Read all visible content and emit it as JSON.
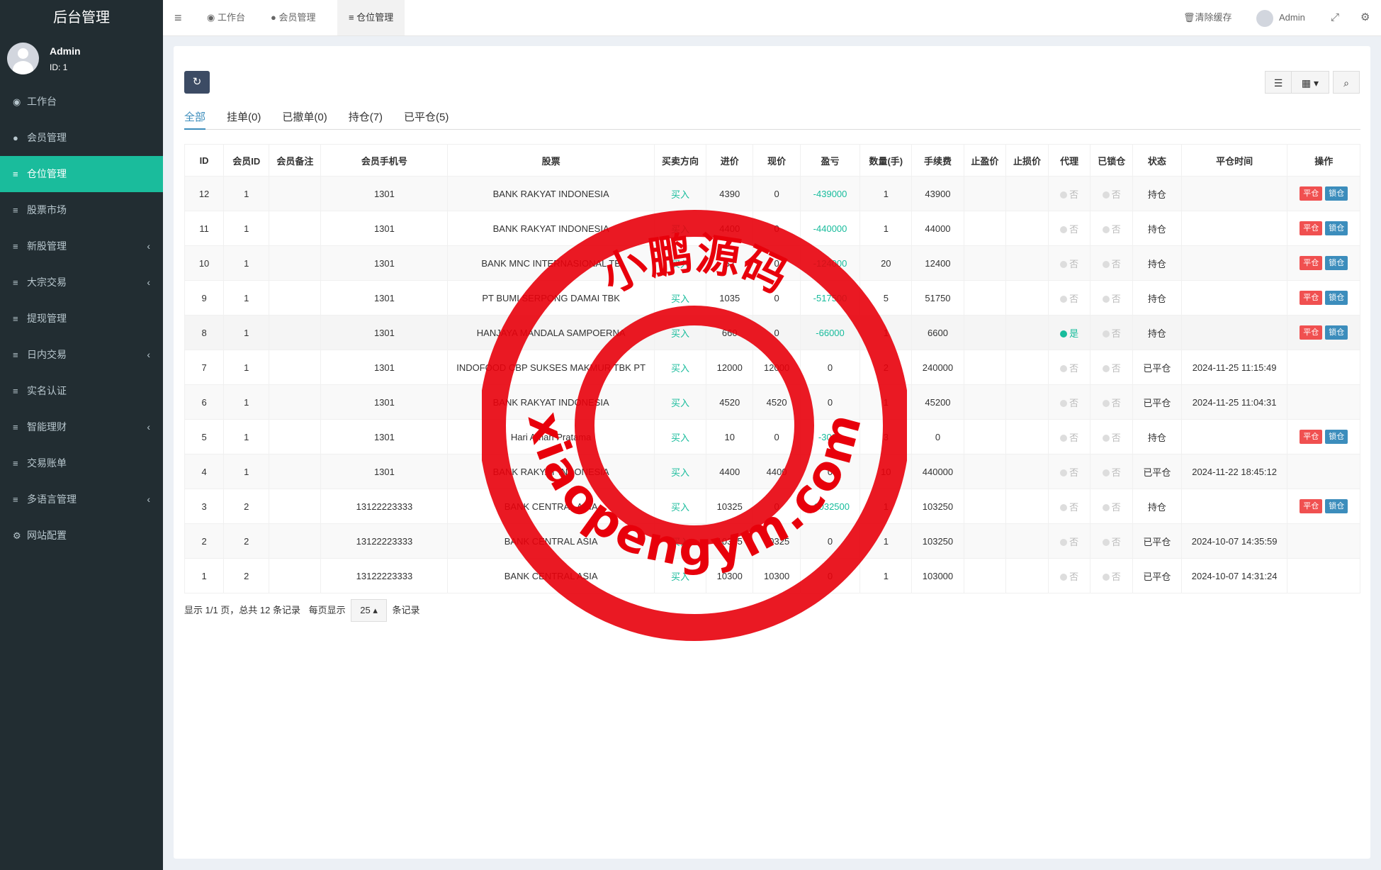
{
  "sidebar": {
    "brand": "后台管理",
    "user": {
      "name": "Admin",
      "id": "ID: 1"
    },
    "items": [
      {
        "label": "工作台",
        "icon": "dashboard-icon",
        "glyph": "◉",
        "arrow": ""
      },
      {
        "label": "会员管理",
        "icon": "user-icon",
        "glyph": "●",
        "arrow": ""
      },
      {
        "label": "仓位管理",
        "icon": "list-icon",
        "glyph": "≡",
        "arrow": "",
        "active": true
      },
      {
        "label": "股票市场",
        "icon": "list-icon",
        "glyph": "≡",
        "arrow": ""
      },
      {
        "label": "新股管理",
        "icon": "list-icon",
        "glyph": "≡",
        "arrow": "‹"
      },
      {
        "label": "大宗交易",
        "icon": "list-icon",
        "glyph": "≡",
        "arrow": "‹"
      },
      {
        "label": "提现管理",
        "icon": "list-icon",
        "glyph": "≡",
        "arrow": ""
      },
      {
        "label": "日内交易",
        "icon": "list-icon",
        "glyph": "≡",
        "arrow": "‹"
      },
      {
        "label": "实名认证",
        "icon": "list-icon",
        "glyph": "≡",
        "arrow": ""
      },
      {
        "label": "智能理财",
        "icon": "list-icon",
        "glyph": "≡",
        "arrow": "‹"
      },
      {
        "label": "交易账单",
        "icon": "list-icon",
        "glyph": "≡",
        "arrow": ""
      },
      {
        "label": "多语言管理",
        "icon": "list-icon",
        "glyph": "≡",
        "arrow": "‹"
      },
      {
        "label": "网站配置",
        "icon": "gear-icon",
        "glyph": "⚙",
        "arrow": ""
      }
    ]
  },
  "header": {
    "menu_icon": "≡",
    "tabs": [
      "工作台",
      "会员管理",
      "仓位管理"
    ],
    "clear_cache": "清除缓存",
    "user": "Admin"
  },
  "filters": [
    "全部",
    "挂单(0)",
    "已撤单(0)",
    "持仓(7)",
    "已平仓(5)"
  ],
  "table": {
    "columns": [
      "ID",
      "会员ID",
      "会员备注",
      "会员手机号",
      "股票",
      "买卖方向",
      "进价",
      "现价",
      "盈亏",
      "数量(手)",
      "手续费",
      "止盈价",
      "止损价",
      "代理",
      "已锁仓",
      "状态",
      "平仓时间",
      "操作"
    ],
    "rows": [
      {
        "id": "12",
        "uid": "1",
        "note": "",
        "phone": "1301",
        "stock": "BANK RAKYAT INDONESIA",
        "dir": "买入",
        "buy": "4390",
        "now": "0",
        "pl": "-439000",
        "qty": "1",
        "fee": "43900",
        "agent": "否",
        "lock": "否",
        "status": "持仓",
        "time": "",
        "ops": true
      },
      {
        "id": "11",
        "uid": "1",
        "note": "",
        "phone": "1301",
        "stock": "BANK RAKYAT INDONESIA",
        "dir": "买入",
        "buy": "4400",
        "now": "0",
        "pl": "-440000",
        "qty": "1",
        "fee": "44000",
        "agent": "否",
        "lock": "否",
        "status": "持仓",
        "time": "",
        "ops": true
      },
      {
        "id": "10",
        "uid": "1",
        "note": "",
        "phone": "1301",
        "stock": "BANK MNC INTERNASIONAL TB",
        "dir": "买入",
        "buy": "62",
        "now": "0",
        "pl": "-124000",
        "qty": "20",
        "fee": "12400",
        "agent": "否",
        "lock": "否",
        "status": "持仓",
        "time": "",
        "ops": true
      },
      {
        "id": "9",
        "uid": "1",
        "note": "",
        "phone": "1301",
        "stock": "PT BUMI SERPONG DAMAI TBK",
        "dir": "买入",
        "buy": "1035",
        "now": "0",
        "pl": "-517500",
        "qty": "5",
        "fee": "51750",
        "agent": "否",
        "lock": "否",
        "status": "持仓",
        "time": "",
        "ops": true
      },
      {
        "id": "8",
        "uid": "1",
        "note": "",
        "phone": "1301",
        "stock": "HANJAYA MANDALA SAMPOERNA",
        "dir": "买入",
        "buy": "660",
        "now": "0",
        "pl": "-66000",
        "qty": "1",
        "fee": "6600",
        "agent": "是",
        "lock": "否",
        "status": "持仓",
        "time": "",
        "ops": true,
        "hl": true
      },
      {
        "id": "7",
        "uid": "1",
        "note": "",
        "phone": "1301",
        "stock": "INDOFOOD CBP SUKSES MAKMUR TBK PT",
        "dir": "买入",
        "buy": "12000",
        "now": "12000",
        "pl": "0",
        "qty": "2",
        "fee": "240000",
        "agent": "否",
        "lock": "否",
        "status": "已平仓",
        "time": "2024-11-25 11:15:49",
        "ops": false
      },
      {
        "id": "6",
        "uid": "1",
        "note": "",
        "phone": "1301",
        "stock": "BANK RAKYAT INDONESIA",
        "dir": "买入",
        "buy": "4520",
        "now": "4520",
        "pl": "0",
        "qty": "1",
        "fee": "45200",
        "agent": "否",
        "lock": "否",
        "status": "已平仓",
        "time": "2024-11-25 11:04:31",
        "ops": false
      },
      {
        "id": "5",
        "uid": "1",
        "note": "",
        "phone": "1301",
        "stock": "Hari Aman Pratama",
        "dir": "买入",
        "buy": "10",
        "now": "0",
        "pl": "-3000",
        "qty": "3",
        "fee": "0",
        "agent": "否",
        "lock": "否",
        "status": "持仓",
        "time": "",
        "ops": true
      },
      {
        "id": "4",
        "uid": "1",
        "note": "",
        "phone": "1301",
        "stock": "BANK RAKYAT INDONESIA",
        "dir": "买入",
        "buy": "4400",
        "now": "4400",
        "pl": "0",
        "qty": "10",
        "fee": "440000",
        "agent": "否",
        "lock": "否",
        "status": "已平仓",
        "time": "2024-11-22 18:45:12",
        "ops": false
      },
      {
        "id": "3",
        "uid": "2",
        "note": "",
        "phone": "13122223333",
        "stock": "BANK CENTRAL ASIA",
        "dir": "买入",
        "buy": "10325",
        "now": "0",
        "pl": "-1032500",
        "qty": "1",
        "fee": "103250",
        "agent": "否",
        "lock": "否",
        "status": "持仓",
        "time": "",
        "ops": true
      },
      {
        "id": "2",
        "uid": "2",
        "note": "",
        "phone": "13122223333",
        "stock": "BANK CENTRAL ASIA",
        "dir": "买入",
        "buy": "10325",
        "now": "10325",
        "pl": "0",
        "qty": "1",
        "fee": "103250",
        "agent": "否",
        "lock": "否",
        "status": "已平仓",
        "time": "2024-10-07 14:35:59",
        "ops": false
      },
      {
        "id": "1",
        "uid": "2",
        "note": "",
        "phone": "13122223333",
        "stock": "BANK CENTRAL ASIA",
        "dir": "买入",
        "buy": "10300",
        "now": "10300",
        "pl": "0",
        "qty": "1",
        "fee": "103000",
        "agent": "否",
        "lock": "否",
        "status": "已平仓",
        "time": "2024-10-07 14:31:24",
        "ops": false
      }
    ],
    "btn_close": "平仓",
    "btn_lock": "锁仓"
  },
  "pager": {
    "summary": "显示 1/1 页，总共 12 条记录",
    "per_page_prefix": "每页显示",
    "per_page": "25",
    "per_page_suffix": "条记录"
  },
  "watermark": {
    "top_text": "小鹏源码",
    "bottom_text": "xiaopengym.com",
    "color": "#e8000b"
  },
  "colors": {
    "sidebar": "#222d32",
    "active": "#1abc9c",
    "accent": "#3c8dbc",
    "danger": "#f05050"
  }
}
